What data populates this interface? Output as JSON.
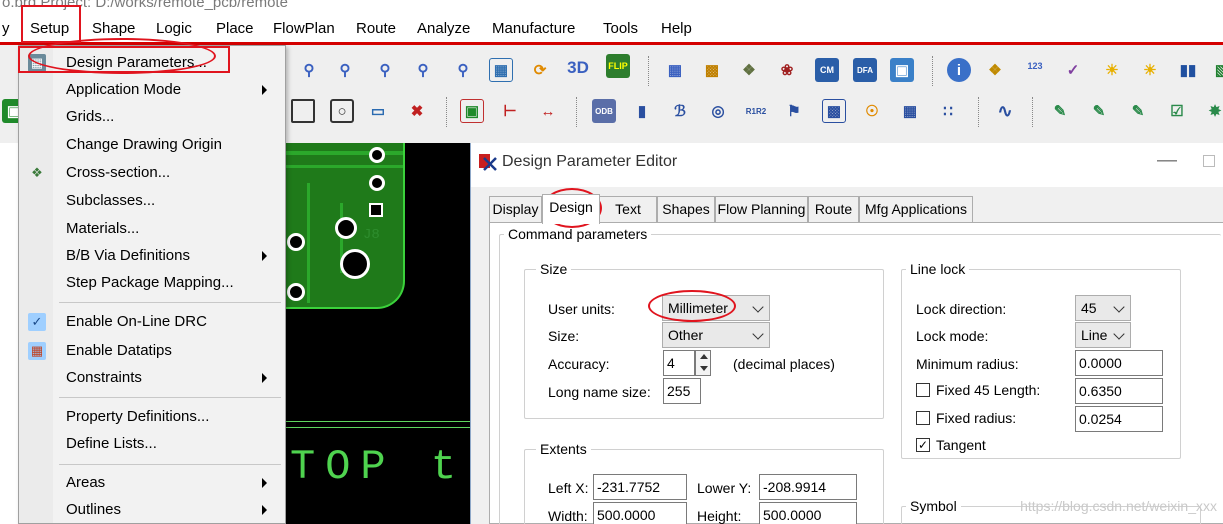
{
  "window": {
    "title": "o.brd  Project: D:/works/remote_pcb/remote"
  },
  "menubar": {
    "items": [
      "y",
      "Setup",
      "Shape",
      "Logic",
      "Place",
      "FlowPlan",
      "Route",
      "Analyze",
      "Manufacture",
      "Tools",
      "Help"
    ]
  },
  "setup_menu": {
    "items": [
      {
        "label": "Design Parameters...",
        "icon": "design-params-icon"
      },
      {
        "label": "Application Mode",
        "submenu": true
      },
      {
        "label": "Grids..."
      },
      {
        "label": "Change Drawing Origin"
      },
      {
        "label": "Cross-section...",
        "icon": "cross-section-icon"
      },
      {
        "label": "Subclasses..."
      },
      {
        "label": "Materials..."
      },
      {
        "label": "B/B Via Definitions",
        "submenu": true
      },
      {
        "label": "Step Package Mapping..."
      },
      {
        "label": "Enable On-Line DRC",
        "icon": "check-icon",
        "checked": true
      },
      {
        "label": "Enable Datatips",
        "icon": "datatips-icon"
      },
      {
        "label": "Constraints",
        "submenu": true
      },
      {
        "label": "Property Definitions..."
      },
      {
        "label": "Define Lists..."
      },
      {
        "label": "Areas",
        "submenu": true
      },
      {
        "label": "Outlines",
        "submenu": true
      }
    ]
  },
  "canvas": {
    "ref_label": "J8",
    "silk_text": "TOP  t"
  },
  "dialog": {
    "title": "Design Parameter Editor",
    "tabs": [
      "Display",
      "Design",
      "Text",
      "Shapes",
      "Flow Planning",
      "Route",
      "Mfg Applications"
    ],
    "active_tab": "Design",
    "command_parameters": "Command parameters",
    "size": {
      "group": "Size",
      "user_units_label": "User units:",
      "user_units": "Millimeter",
      "size_label": "Size:",
      "size_value": "Other",
      "accuracy_label": "Accuracy:",
      "accuracy": "4",
      "accuracy_suffix": "(decimal places)",
      "long_name_label": "Long name size:",
      "long_name": "255"
    },
    "extents": {
      "group": "Extents",
      "left_x_label": "Left X:",
      "left_x": "-231.7752",
      "lower_y_label": "Lower Y:",
      "lower_y": "-208.9914",
      "width_label": "Width:",
      "width": "500.0000",
      "height_label": "Height:",
      "height": "500.0000"
    },
    "line_lock": {
      "group": "Line lock",
      "lock_direction_label": "Lock direction:",
      "lock_direction": "45",
      "lock_mode_label": "Lock mode:",
      "lock_mode": "Line",
      "min_radius_label": "Minimum radius:",
      "min_radius": "0.0000",
      "fixed45_label": "Fixed 45 Length:",
      "fixed45": "0.6350",
      "fixed_radius_label": "Fixed radius:",
      "fixed_radius": "0.0254",
      "tangent_label": "Tangent"
    },
    "symbol": {
      "group": "Symbol"
    }
  },
  "watermark": "https://blog.csdn.net/weixin_xxx",
  "colors": {
    "accent_red": "#e0141e",
    "pcb_green": "#2ba82b"
  }
}
